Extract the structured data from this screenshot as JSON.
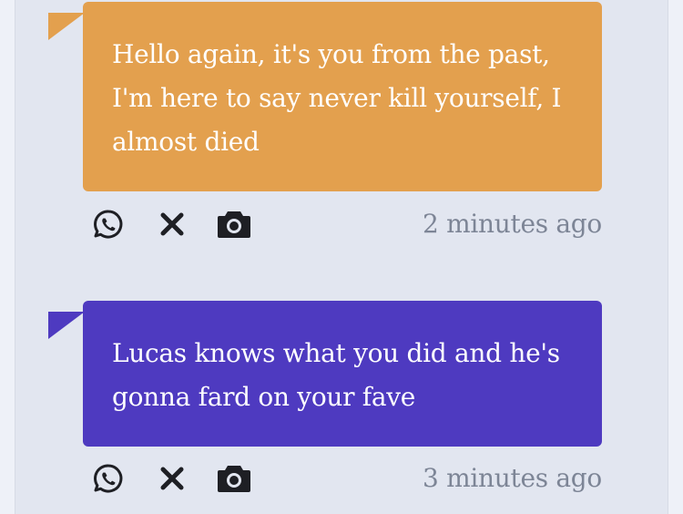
{
  "messages": [
    {
      "text": "Hello again, it's you from the past, I'm here to say never kill yourself, I almost died",
      "time": "2 minutes ago",
      "color": "#e3a04e"
    },
    {
      "text": "Lucas knows what you did and he's gonna fard on your fave",
      "time": "3 minutes ago",
      "color": "#4e3ac0"
    }
  ],
  "icons": [
    "whatsapp-icon",
    "close-icon",
    "camera-icon"
  ]
}
